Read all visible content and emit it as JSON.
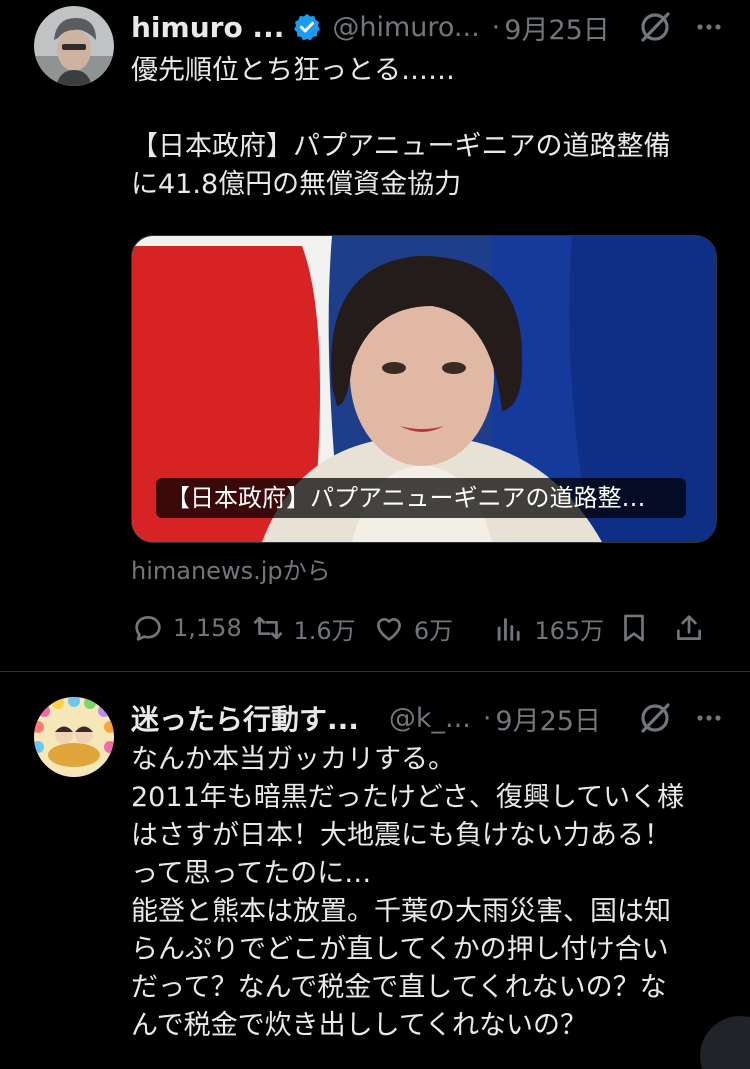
{
  "tweet1": {
    "display_name": "himuro ...",
    "handle": "@himuro...",
    "separator": "·",
    "time": "9月25日",
    "text": "優先順位とち狂っとる……\n\n【日本政府】パプアニューギニアの道路整備\nに41.8億円の無償資金協力",
    "card_title": "【日本政府】パプアニューギニアの道路整…",
    "source": "himanews.jpから",
    "replies": "1,158",
    "retweets": "1.6万",
    "likes": "6万",
    "views": "165万",
    "icons": [
      "grok-icon",
      "more-icon",
      "reply-icon",
      "retweet-icon",
      "like-icon",
      "views-icon",
      "bookmark-icon",
      "share-icon",
      "verified-badge-icon"
    ],
    "accent": "#1d9bf0"
  },
  "tweet2": {
    "display_name": "迷ったら行動す...",
    "handle": "@k_...",
    "separator": "·",
    "time": "9月25日",
    "text": "なんか本当ガッカリする。\n2011年も暗黒だったけどさ、復興していく様\nはさすが日本！大地震にも負けない力ある！\nって思ってたのに…\n能登と熊本は放置。千葉の大雨災害、国は知\nらんぷりでどこが直してくかの押し付け合い\nだって？なんで税金で直してくれないの？な\nんで税金で炊き出ししてくれないの？",
    "icons": [
      "grok-icon",
      "more-icon"
    ]
  }
}
